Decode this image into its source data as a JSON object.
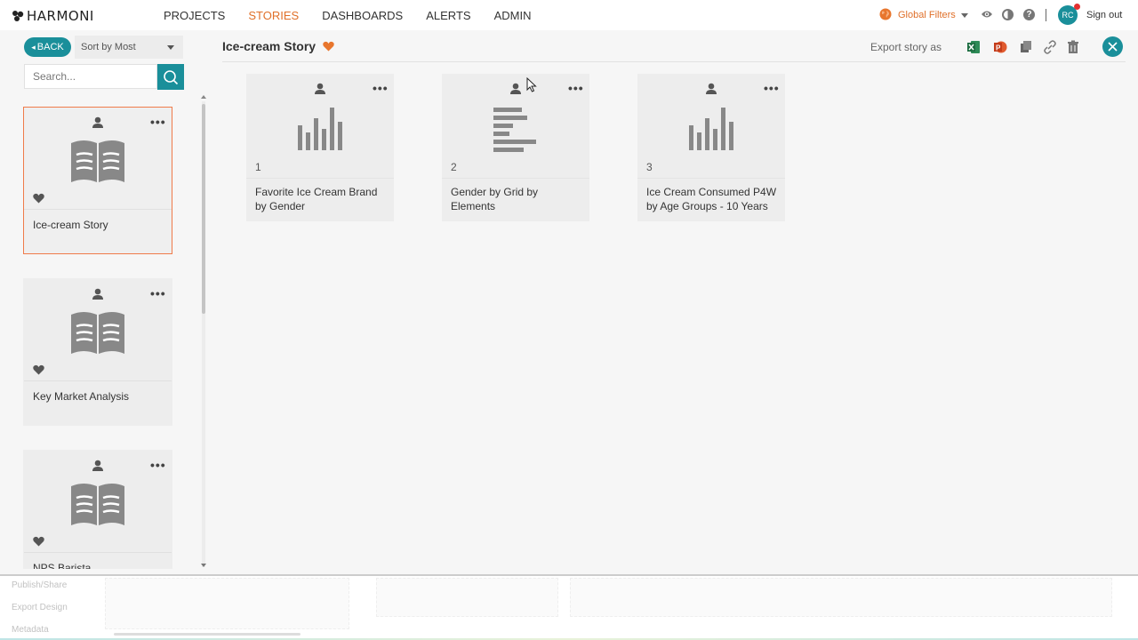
{
  "app": {
    "brand": "HARMONI"
  },
  "nav": {
    "items": [
      "PROJECTS",
      "STORIES",
      "DASHBOARDS",
      "ALERTS",
      "ADMIN"
    ],
    "active": "STORIES"
  },
  "topbar": {
    "global_filters": "Global Filters",
    "avatar_initials": "RC",
    "sign_out": "Sign out"
  },
  "sidebar": {
    "back_label": "BACK",
    "sort_label": "Sort by Most",
    "search_placeholder": "Search...",
    "stories": [
      {
        "title": "Ice-cream Story",
        "selected": true
      },
      {
        "title": "Key Market Analysis",
        "selected": false
      },
      {
        "title": "NPS Barista",
        "selected": false
      }
    ]
  },
  "story": {
    "title": "Ice-cream Story",
    "export_label": "Export story as"
  },
  "slides": [
    {
      "number": "1",
      "title": "Favorite Ice Cream Brand by Gender",
      "thumb": "vertical-bars-icon"
    },
    {
      "number": "2",
      "title": "Gender by Grid by Elements",
      "thumb": "horizontal-bars-icon"
    },
    {
      "number": "3",
      "title": "Ice Cream Consumed P4W by Age Groups - 10 Years",
      "thumb": "vertical-bars-icon"
    }
  ],
  "bottom_menu": [
    "Publish/Share",
    "Export Design",
    "Metadata"
  ],
  "colors": {
    "accent_teal": "#1a8f9a",
    "accent_orange": "#e0702a",
    "selected_border": "#ef7b4a"
  }
}
